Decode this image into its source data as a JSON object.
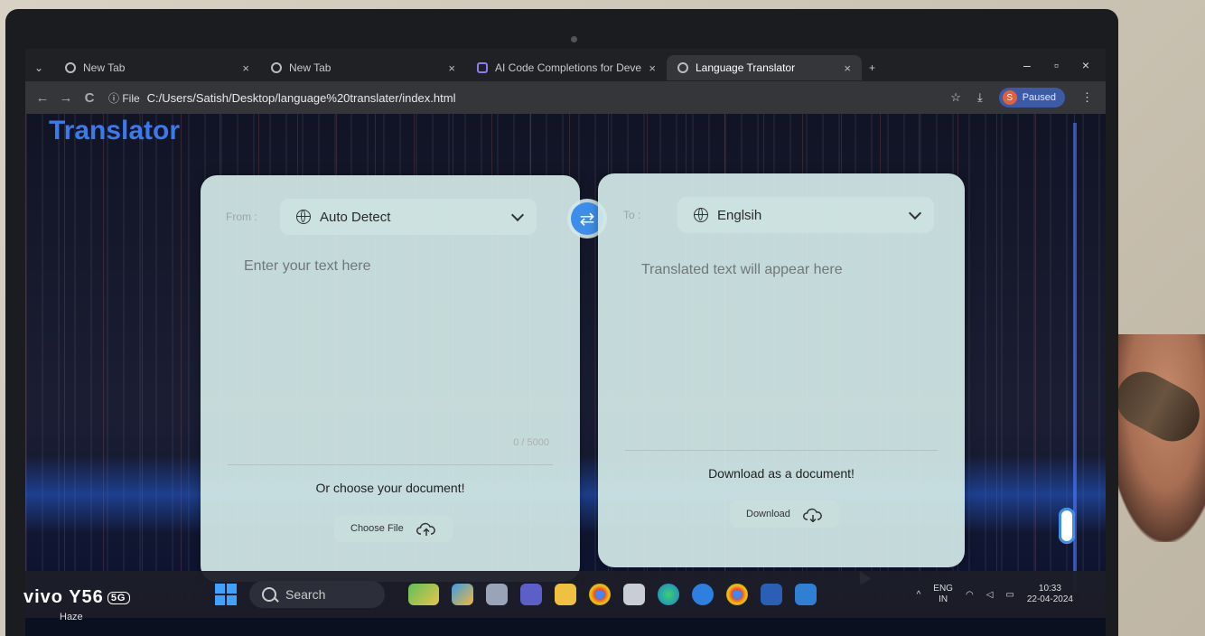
{
  "browser": {
    "tabs": [
      {
        "title": "New Tab",
        "active": false,
        "icon": "chrome-icon"
      },
      {
        "title": "New Tab",
        "active": false,
        "icon": "chrome-icon"
      },
      {
        "title": "AI Code Completions for Deve",
        "active": false,
        "icon": "ai-icon"
      },
      {
        "title": "Language Translator",
        "active": true,
        "icon": "globe-icon"
      }
    ],
    "new_tab_symbol": "+",
    "close_symbol": "×",
    "menu_symbol": "⌄",
    "window_controls": {
      "minimize": "–",
      "maximize": "▫",
      "close": "×"
    },
    "nav": {
      "back": "←",
      "forward": "→",
      "reload": "C"
    },
    "address": {
      "scheme_label": "ⓘ File",
      "url": "C:/Users/Satish/Desktop/language%20translater/index.html"
    },
    "bookmark_symbol": "☆",
    "download_symbol": "⤓",
    "profile": {
      "avatar": "S",
      "status": "Paused"
    },
    "more_symbol": "⋮"
  },
  "app": {
    "title": "Translator",
    "from": {
      "label": "From :",
      "language": "Auto Detect",
      "placeholder": "Enter your text here",
      "char_count": "0 / 5000",
      "doc_hint": "Or choose your document!",
      "file_button": "Choose File"
    },
    "swap_symbol": "⇄",
    "to": {
      "label": "To :",
      "language": "Englsih",
      "placeholder": "Translated text will appear here",
      "doc_hint": "Download as a document!",
      "download_button": "Download"
    }
  },
  "taskbar": {
    "search_label": "Search",
    "tray": {
      "chevron": "^",
      "lang_top": "ENG",
      "lang_bottom": "IN",
      "time": "10:33",
      "date": "22-04-2024"
    }
  },
  "overlay": {
    "brand": "vivo Y56",
    "brand_badge": "5G",
    "weather": "Haze"
  }
}
